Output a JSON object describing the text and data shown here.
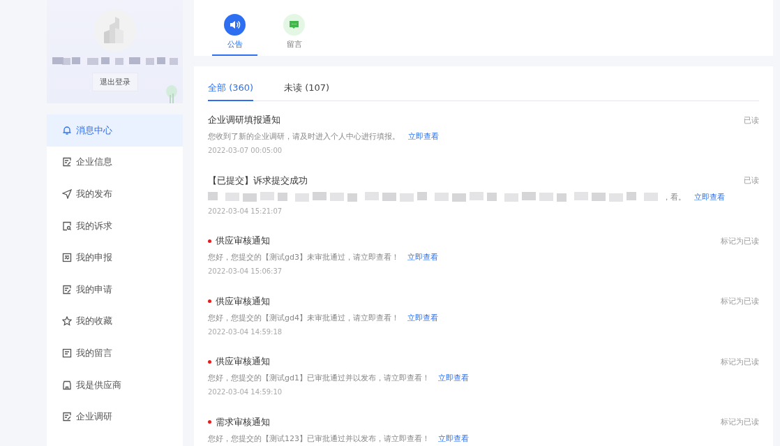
{
  "profile": {
    "logout": "退出登录"
  },
  "sidebar": {
    "items": [
      {
        "label": "消息中心",
        "kind": "bell",
        "selected": true
      },
      {
        "label": "企业信息",
        "kind": "form",
        "selected": false
      },
      {
        "label": "我的发布",
        "kind": "send",
        "selected": false
      },
      {
        "label": "我的诉求",
        "kind": "search",
        "selected": false
      },
      {
        "label": "我的申报",
        "kind": "report",
        "selected": false
      },
      {
        "label": "我的申请",
        "kind": "form",
        "selected": false
      },
      {
        "label": "我的收藏",
        "kind": "star",
        "selected": false
      },
      {
        "label": "我的留言",
        "kind": "message",
        "selected": false
      },
      {
        "label": "我是供应商",
        "kind": "store",
        "selected": false
      },
      {
        "label": "企业调研",
        "kind": "form",
        "selected": false
      }
    ]
  },
  "top_tabs": [
    {
      "label": "公告",
      "kind": "speaker",
      "selected": true
    },
    {
      "label": "留言",
      "kind": "chat",
      "selected": false
    }
  ],
  "filter_tabs": [
    {
      "label": "全部 (360)",
      "selected": true
    },
    {
      "label": "未读 (107)",
      "selected": false
    }
  ],
  "messages": [
    {
      "title": "企业调研填报通知",
      "unread": false,
      "status": "已读",
      "body": "您收到了新的企业调研，请及时进入个人中心进行填报。",
      "blurred": false,
      "link": "立即查看",
      "time": "2022-03-07 00:05:00"
    },
    {
      "title": "【已提交】诉求提交成功",
      "unread": false,
      "status": "已读",
      "body": "，看。",
      "blurred": true,
      "link": "立即查看",
      "time": "2022-03-04 15:21:07"
    },
    {
      "title": "供应审核通知",
      "unread": true,
      "status": "标记为已读",
      "body": "您好，您提交的【测试gd3】未审批通过，请立即查看！",
      "blurred": false,
      "link": "立即查看",
      "time": "2022-03-04 15:06:37"
    },
    {
      "title": "供应审核通知",
      "unread": true,
      "status": "标记为已读",
      "body": "您好，您提交的【测试gd4】未审批通过，请立即查看！",
      "blurred": false,
      "link": "立即查看",
      "time": "2022-03-04 14:59:18"
    },
    {
      "title": "供应审核通知",
      "unread": true,
      "status": "标记为已读",
      "body": "您好，您提交的【测试gd1】已审批通过并以发布，请立即查看！",
      "blurred": false,
      "link": "立即查看",
      "time": "2022-03-04 14:59:10"
    },
    {
      "title": "需求审核通知",
      "unread": true,
      "status": "标记为已读",
      "body": "您好，您提交的【测试123】已审批通过并以发布，请立即查看！",
      "blurred": false,
      "link": "立即查看"
    }
  ]
}
